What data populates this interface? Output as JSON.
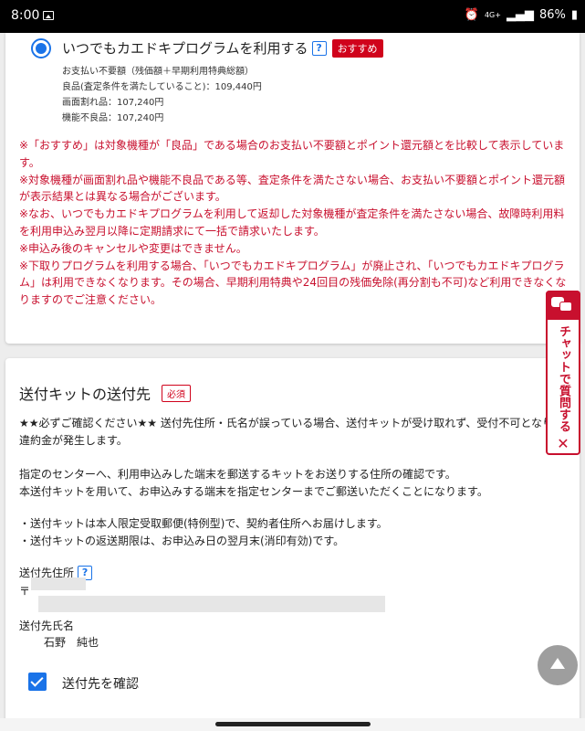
{
  "status_bar": {
    "time": "8:00",
    "network": "4G+",
    "battery": "86%"
  },
  "option": {
    "label": "いつでもカエドキプログラムを利用する",
    "help": "?",
    "badge": "おすすめ",
    "details": [
      "お支払い不要額（残価額＋早期利用特典総額）",
      "良品(査定条件を満たしていること)：109,440円",
      "画面割れ品：107,240円",
      "機能不良品：107,240円"
    ]
  },
  "notes": [
    "※「おすすめ」は対象機種が「良品」である場合のお支払い不要額とポイント還元額とを比較して表示しています。",
    "※対象機種が画面割れ品や機能不良品である等、査定条件を満たさない場合、お支払い不要額とポイント還元額が表示結果とは異なる場合がございます。",
    "※なお、いつでもカエドキプログラムを利用して返却した対象機種が査定条件を満たさない場合、故障時利用料を利用申込み翌月以降に定期請求にて一括で請求いたします。",
    "※申込み後のキャンセルや変更はできません。",
    "※下取りプログラムを利用する場合、「いつでもカエドキプログラム」が廃止され、「いつでもカエドキプログラム」は利用できなくなります。その場合、早期利用特典や24回目の残価免除(再分割も不可)など利用できなくなりますのでご注意ください。"
  ],
  "kit": {
    "title": "送付キットの送付先",
    "required": "必須",
    "warning": "★★必ずご確認ください★★ 送付先住所・氏名が誤っている場合、送付キットが受け取れず、受付不可となり違約金が発生します。",
    "intro": [
      "指定のセンターへ、利用申込みした端末を郵送するキットをお送りする住所の確認です。",
      "本送付キットを用いて、お申込みする端末を指定センターまでご郵送いただくことになります。"
    ],
    "bullets": [
      "・送付キットは本人限定受取郵便(特例型)で、契約者住所へお届けします。",
      "・送付キットの返送期限は、お申込み日の翌月末(消印有効)です。"
    ],
    "address_label": "送付先住所",
    "address_help": "?",
    "zip_mark": "〒",
    "name_label": "送付先氏名",
    "name_value": "石野　純也",
    "confirm_label": "送付先を確認"
  },
  "chat": {
    "label": "チャットで質問する",
    "close": "✕"
  }
}
